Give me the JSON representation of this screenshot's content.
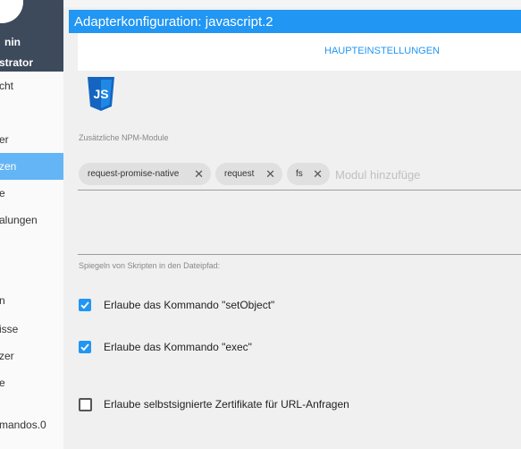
{
  "sidebar": {
    "user_first": "nin",
    "user_second": "strator",
    "items": [
      {
        "label": "cht",
        "active": false
      },
      {
        "label": "er",
        "active": false
      },
      {
        "label": "zen",
        "active": true
      },
      {
        "label": "e",
        "active": false
      },
      {
        "label": "alungen",
        "active": false
      },
      {
        "label": "n",
        "active": false
      },
      {
        "label": "isse",
        "active": false
      },
      {
        "label": "zer",
        "active": false
      },
      {
        "label": "e",
        "active": false
      },
      {
        "label": "mandos.0",
        "active": false
      }
    ]
  },
  "header": {
    "title": "Adapterkonfiguration: javascript.2",
    "tab_main": "HAUPTEINSTELLUNGEN"
  },
  "logo": {
    "text": "JS",
    "color": "#1565c0"
  },
  "npm": {
    "label": "Zusätzliche NPM-Module",
    "chips": [
      "request-promise-native",
      "request",
      "fs"
    ],
    "placeholder": "Modul hinzufüge"
  },
  "mirror": {
    "label": "Spiegeln von Skripten in den Dateipfad:"
  },
  "options": [
    {
      "label": "Erlaube das Kommando \"setObject\"",
      "checked": true
    },
    {
      "label": "Erlaube das Kommando \"exec\"",
      "checked": true
    },
    {
      "label": "Erlaube selbstsignierte Zertifikate für URL-Anfragen",
      "checked": false
    }
  ],
  "colors": {
    "accent": "#2196f3",
    "sidebar_header": "#3c4a5c",
    "sidebar_active": "#64b5f6"
  }
}
